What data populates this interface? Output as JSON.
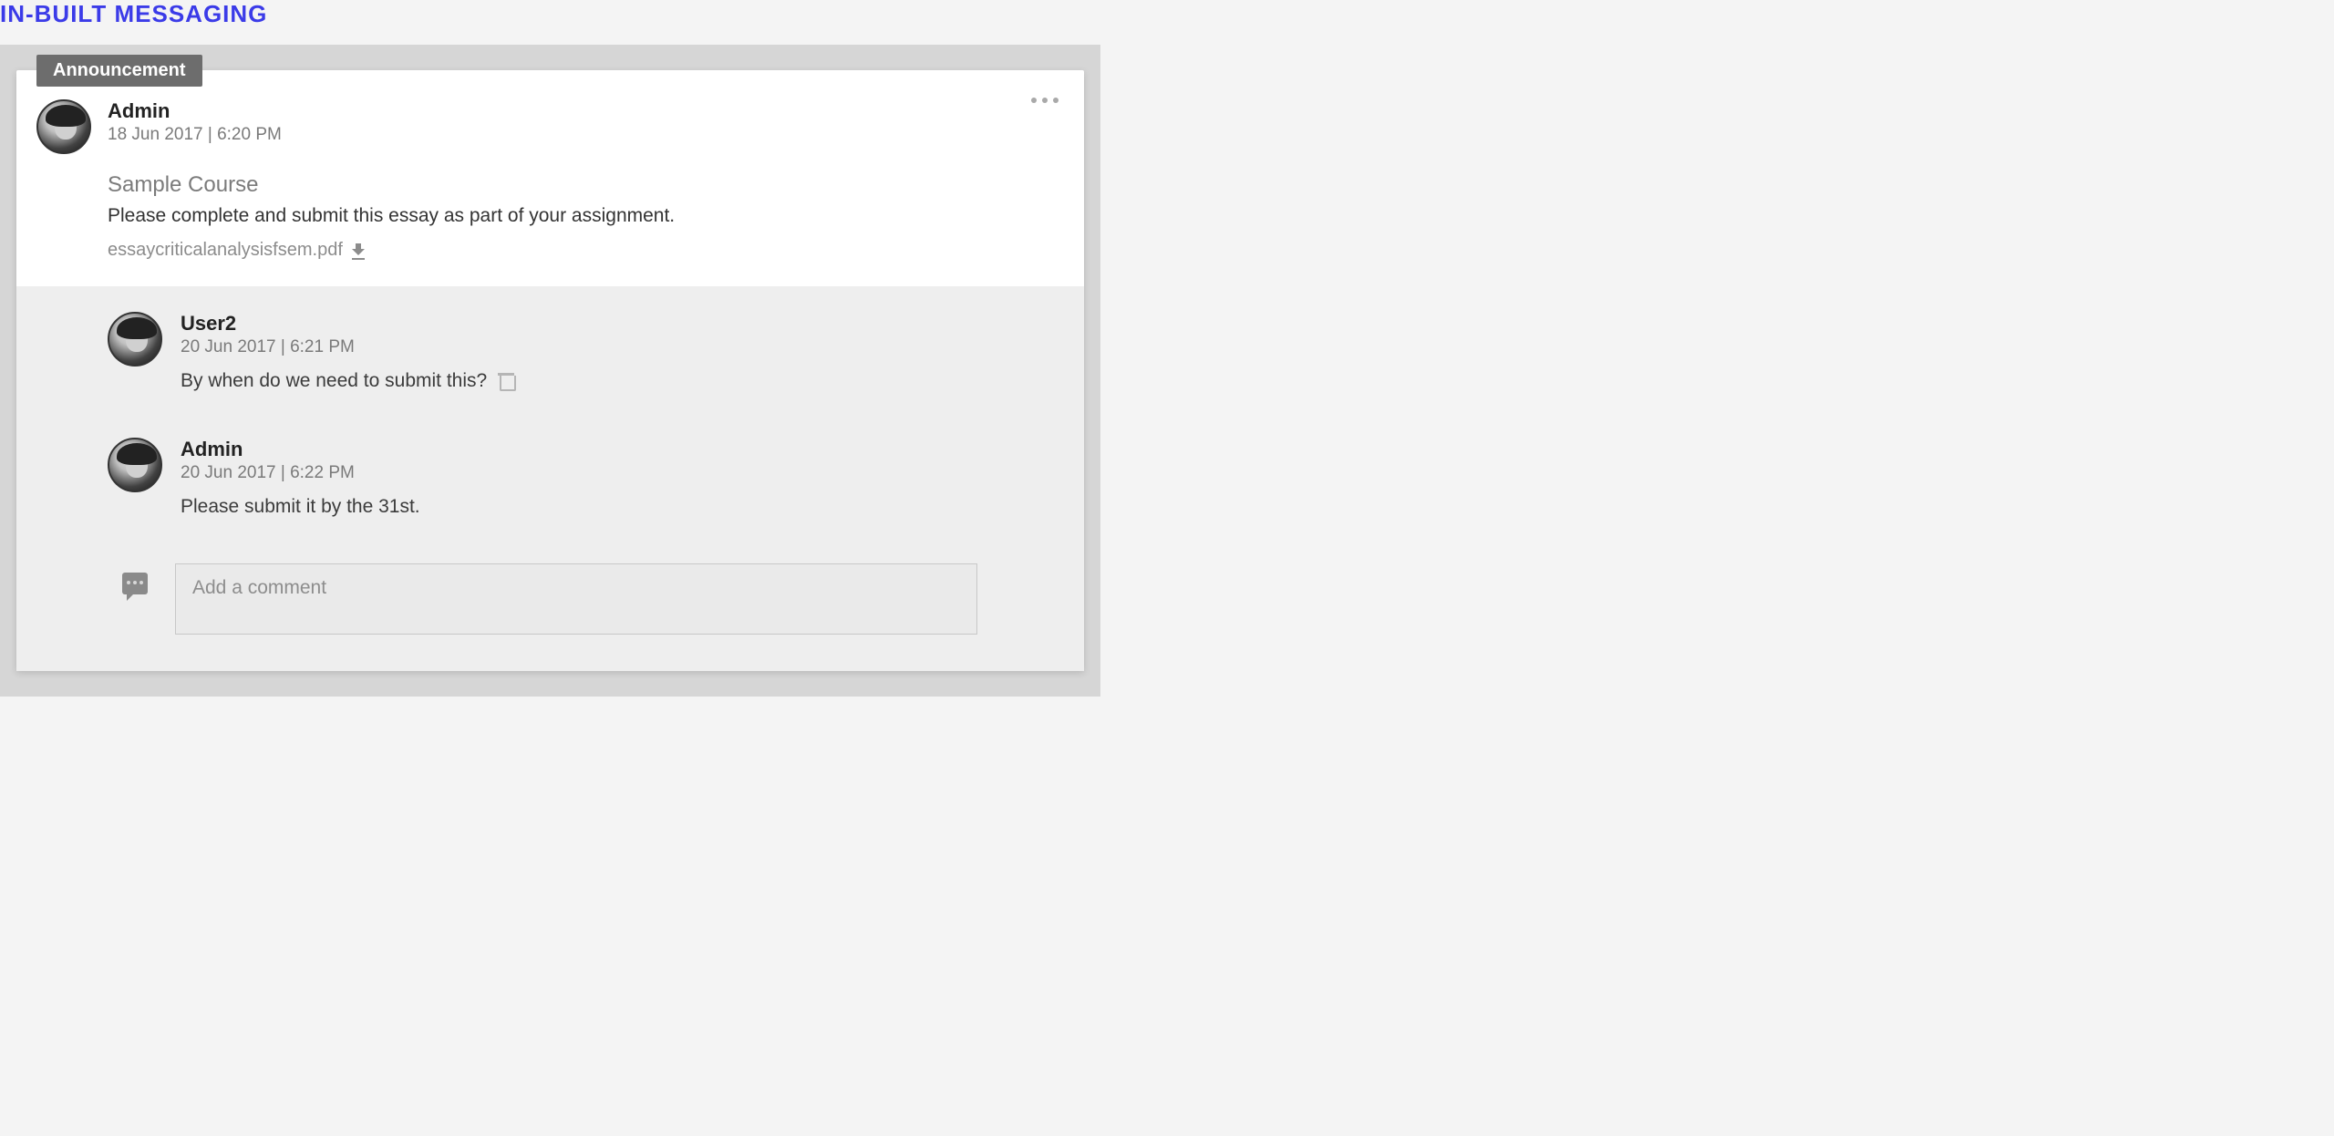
{
  "page": {
    "title": "IN-BUILT MESSAGING"
  },
  "announcement": {
    "tab_label": "Announcement",
    "author": "Admin",
    "timestamp": "18 Jun 2017 | 6:20 PM",
    "course": "Sample Course",
    "body": "Please complete and submit this essay as part of your assignment.",
    "attachment_name": "essaycriticalanalysisfsem.pdf"
  },
  "comments": [
    {
      "author": "User2",
      "timestamp": "20 Jun 2017 | 6:21 PM",
      "text": "By when do we need to submit this?",
      "deletable": true
    },
    {
      "author": "Admin",
      "timestamp": "20 Jun 2017 | 6:22 PM",
      "text": "Please submit it by the 31st.",
      "deletable": false
    }
  ],
  "compose": {
    "placeholder": "Add a comment"
  }
}
